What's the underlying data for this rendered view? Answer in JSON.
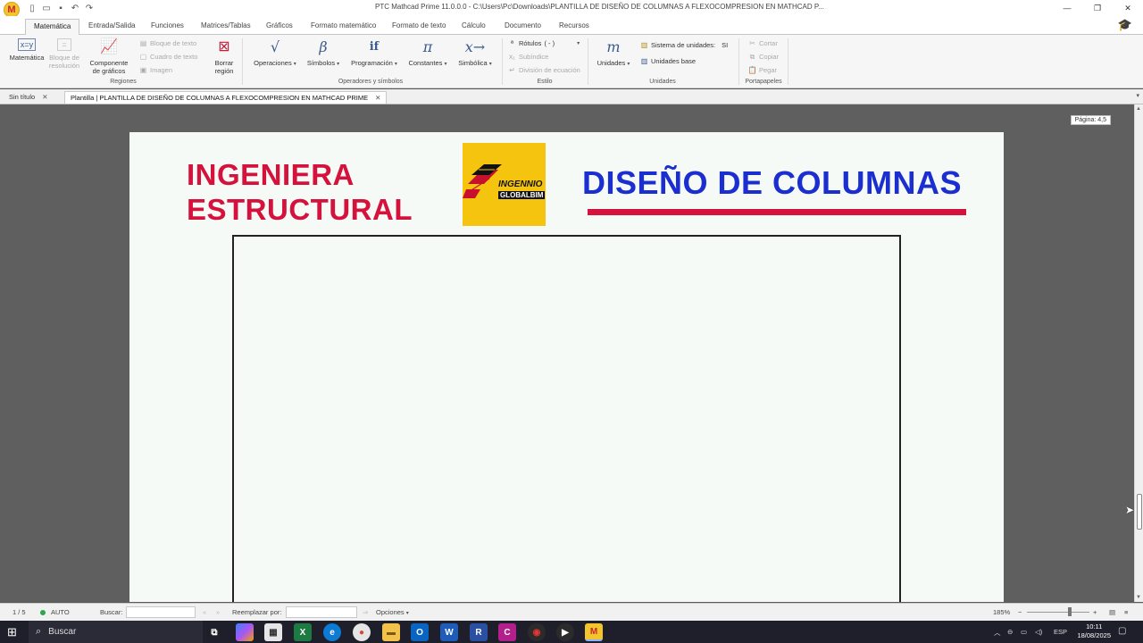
{
  "window": {
    "title": "PTC Mathcad Prime 11.0.0.0 - C:\\Users\\Pc\\Downloads\\PLANTILLA DE DISEÑO DE COLUMNAS A FLEXOCOMPRESION EN MATHCAD P...",
    "logo_letter": "M",
    "minimize": "—",
    "restore": "❐",
    "close": "✕"
  },
  "ribbon_tabs": [
    "Matemática",
    "Entrada/Salida",
    "Funciones",
    "Matrices/Tablas",
    "Gráficos",
    "Formato matemático",
    "Formato de texto",
    "Cálculo",
    "Documento",
    "Recursos"
  ],
  "ribbon": {
    "regiones": {
      "matematica": "Matemática",
      "bloque_resolucion": "Bloque de resolución",
      "componente_graficos": "Componente de gráficos",
      "bloque_texto": "Bloque de texto",
      "cuadro_texto": "Cuadro de texto",
      "imagen": "Imagen",
      "borrar_region": "Borrar región",
      "label": "Regiones"
    },
    "operadores": {
      "operaciones": "Operaciones",
      "simbolos": "Símbolos",
      "programacion": "Programación",
      "constantes": "Constantes",
      "simbolica": "Simbólica",
      "label": "Operadores y símbolos"
    },
    "estilo": {
      "rotulos": "Rótulos",
      "rotulos_value": "( - )",
      "subindice": "Subíndice",
      "division": "División de ecuación",
      "label": "Estilo"
    },
    "unidades": {
      "unidades": "Unidades",
      "sistema": "Sistema de unidades:",
      "sistema_value": "SI",
      "unidades_base": "Unidades base",
      "label": "Unidades"
    },
    "portapapeles": {
      "cortar": "Cortar",
      "copiar": "Copiar",
      "pegar": "Pegar",
      "label": "Portapapeles"
    }
  },
  "doc_tabs": [
    {
      "label": "Sin título"
    },
    {
      "label": "Plantilla | PLANTILLA DE DISEÑO DE COLUMNAS A FLEXOCOMPRESION EN MATHCAD PRIME"
    }
  ],
  "document": {
    "title_left_1": "INGENIERA",
    "title_left_2": "ESTRUCTURAL",
    "logo_text_1": "INGENNIO",
    "logo_text_2": "GLOBALBIM",
    "title_right": "DISEÑO DE COLUMNAS",
    "page_indicator": "Página: 4,5",
    "colors": {
      "red": "#d4123c",
      "blue": "#1b2fd0",
      "logo_yellow": "#f5c40f"
    }
  },
  "statusbar": {
    "page": "1 / 5",
    "mode": "AUTO",
    "buscar": "Buscar:",
    "reemplazar": "Reemplazar por:",
    "opciones": "Opciones",
    "zoom": "185%"
  },
  "taskbar": {
    "search": "Buscar",
    "lang": "ESP",
    "time": "10:11",
    "date": "18/08/2025"
  }
}
